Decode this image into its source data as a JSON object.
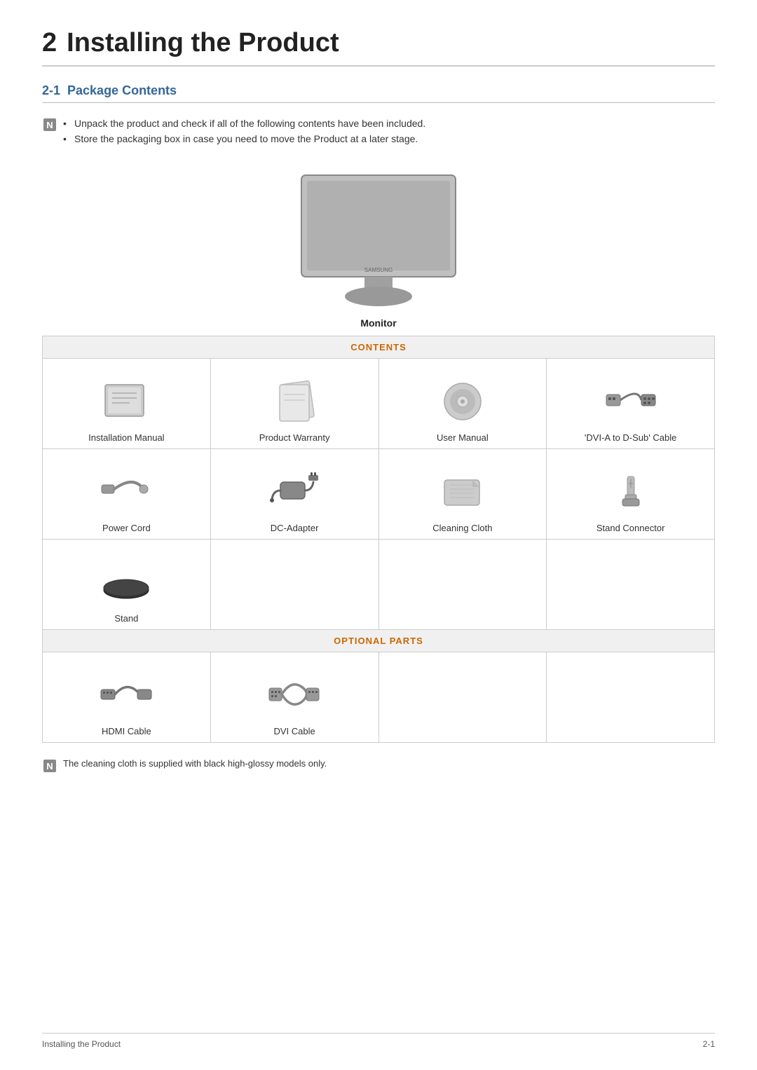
{
  "page": {
    "chapter_num": "2",
    "chapter_title": "Installing the Product",
    "section_num": "2-1",
    "section_title": "Package Contents",
    "note1": "Unpack the product and check if all of the following contents have been included.",
    "note2": "Store the packaging box in case you need to move the Product at a later stage.",
    "monitor_label": "Monitor",
    "contents_header": "CONTENTS",
    "optional_header": "OPTIONAL PARTS",
    "bottom_note": "The cleaning cloth is supplied with black high-glossy models only.",
    "footer_left": "Installing the Product",
    "footer_right": "2-1"
  },
  "contents_items": [
    {
      "label": "Installation Manual",
      "icon": "manual"
    },
    {
      "label": "Product Warranty",
      "icon": "warranty"
    },
    {
      "label": "User Manual",
      "icon": "cd"
    },
    {
      "label": "'DVI-A to D-Sub' Cable",
      "icon": "dvi-cable"
    },
    {
      "label": "Power Cord",
      "icon": "power-cord"
    },
    {
      "label": "DC-Adapter",
      "icon": "dc-adapter"
    },
    {
      "label": "Cleaning Cloth",
      "icon": "cloth"
    },
    {
      "label": "Stand Connector",
      "icon": "stand-connector"
    },
    {
      "label": "Stand",
      "icon": "stand"
    },
    {
      "label": "",
      "icon": ""
    },
    {
      "label": "",
      "icon": ""
    },
    {
      "label": "",
      "icon": ""
    }
  ],
  "optional_items": [
    {
      "label": "HDMI Cable",
      "icon": "hdmi-cable"
    },
    {
      "label": "DVI Cable",
      "icon": "dvi-cable2"
    },
    {
      "label": "",
      "icon": ""
    },
    {
      "label": "",
      "icon": ""
    }
  ]
}
